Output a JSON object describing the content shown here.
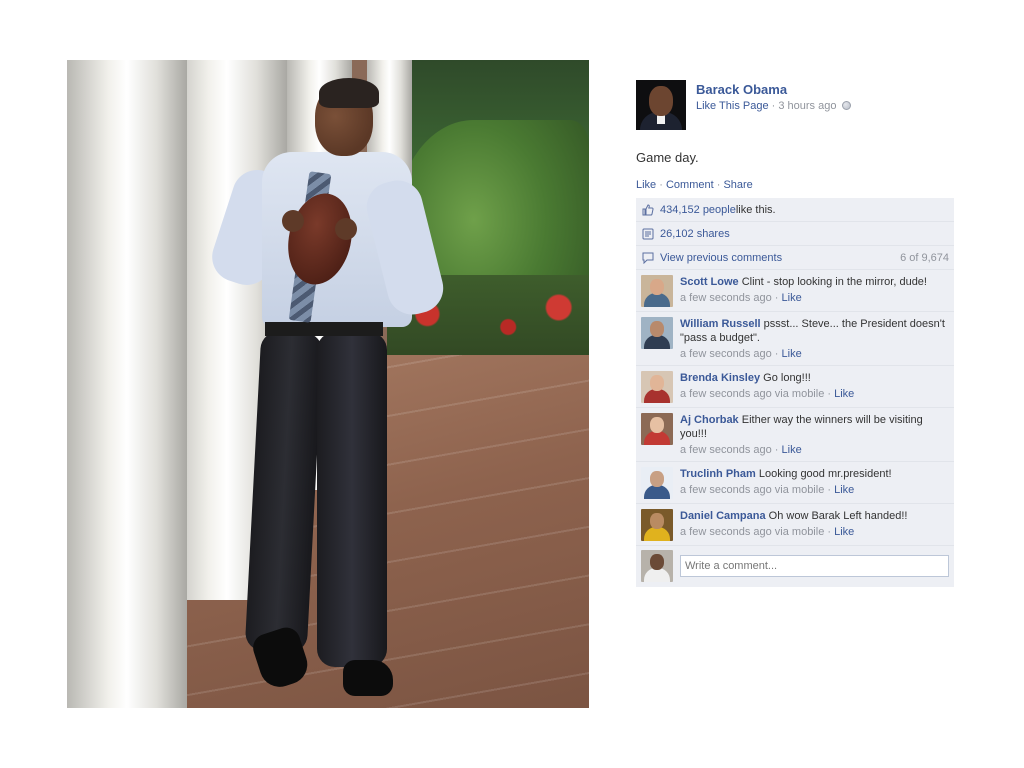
{
  "post": {
    "author": "Barack Obama",
    "like_page": "Like This Page",
    "separator": " · ",
    "time": "3 hours ago",
    "status": "Game day.",
    "actions": {
      "like": "Like",
      "comment": "Comment",
      "share": "Share"
    }
  },
  "ufi": {
    "likes_count": "434,152 people",
    "likes_suffix": " like this.",
    "shares": "26,102 shares",
    "view_previous": "View previous comments",
    "comment_count": "6 of 9,674"
  },
  "comments": [
    {
      "name": "Scott Lowe",
      "text": " Clint - stop looking in the mirror, dude!",
      "time": "a few seconds ago",
      "via": "",
      "like": "Like"
    },
    {
      "name": "William Russell",
      "text": " pssst... Steve... the President doesn't \"pass a budget\".",
      "time": "a few seconds ago",
      "via": "",
      "like": "Like"
    },
    {
      "name": "Brenda Kinsley",
      "text": " Go long!!!",
      "time": "a few seconds ago",
      "via": " via mobile",
      "like": "Like"
    },
    {
      "name": "Aj Chorbak",
      "text": " Either way the winners will be visiting you!!!",
      "time": "a few seconds ago",
      "via": "",
      "like": "Like"
    },
    {
      "name": "Truclinh Pham",
      "text": " Looking good mr.president!",
      "time": "a few seconds ago",
      "via": " via mobile",
      "like": "Like"
    },
    {
      "name": "Daniel Campana",
      "text": " Oh wow Barak Left handed!!",
      "time": "a few seconds ago",
      "via": " via mobile",
      "like": "Like"
    }
  ],
  "composer": {
    "placeholder": "Write a comment..."
  },
  "icons": {
    "like": "thumbs-up-icon",
    "share": "share-icon",
    "comments": "speech-bubble-icon",
    "privacy": "globe-icon"
  },
  "colors": {
    "link": "#3b5998",
    "meta": "#90949c",
    "ufi_bg": "#edeff4"
  }
}
